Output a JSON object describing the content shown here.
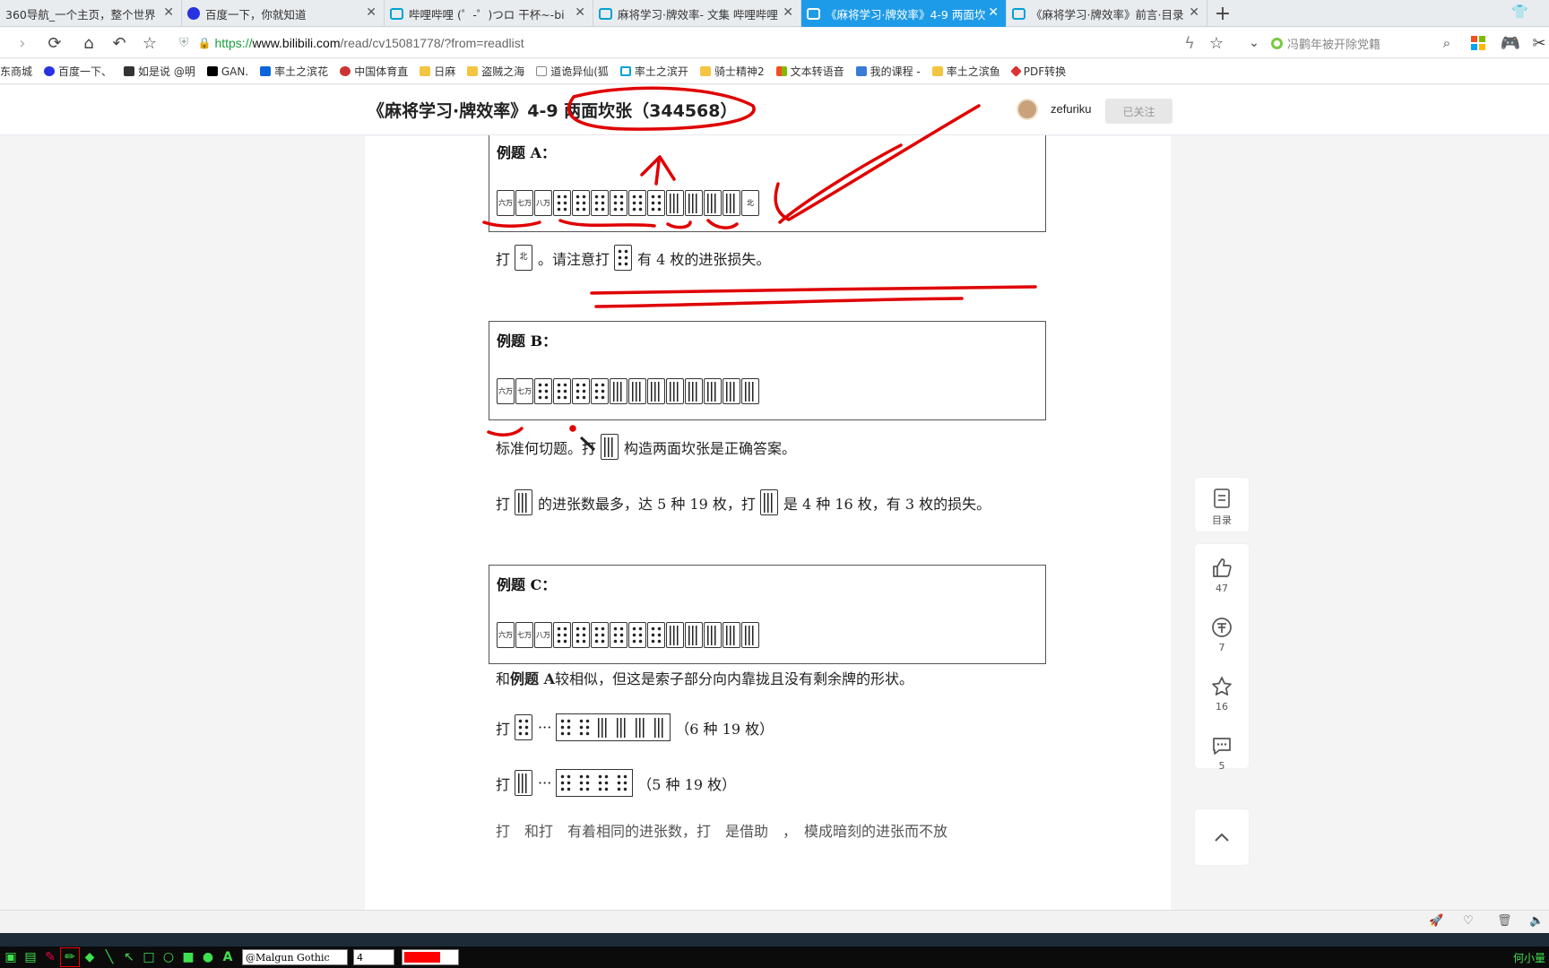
{
  "tabs": [
    {
      "title": "360导航_一个主页，整个世界",
      "icon": "nav360-icon",
      "active": false
    },
    {
      "title": "百度一下，你就知道",
      "icon": "baidu-icon",
      "active": false
    },
    {
      "title": "哔哩哔哩 (゜-゜)つロ 干杯~-bi",
      "icon": "bilibili-icon",
      "active": false
    },
    {
      "title": "麻将学习·牌效率- 文集 哔哩哔哩",
      "icon": "bilibili-icon",
      "active": false
    },
    {
      "title": "《麻将学习·牌效率》4-9 两面坎",
      "icon": "bilibili-icon",
      "active": true
    },
    {
      "title": "《麻将学习·牌效率》前言·目录",
      "icon": "bilibili-icon",
      "active": false
    }
  ],
  "address": {
    "scheme": "https://",
    "host": "www.bilibili.com",
    "path": "/read/cv15081778/?from=readlist",
    "search_placeholder": "冯鹳年被开除党籍"
  },
  "bookmarks": [
    "东商城",
    "百度一下、",
    "如是说 @明",
    "GAN.",
    "率土之滨花",
    "中国体育直",
    "日麻",
    "盗贼之海",
    "道诡异仙(狐",
    "率土之滨开",
    "骑士精神2",
    "文本转语音",
    "我的课程 -",
    "率土之滨鱼",
    "PDF转换"
  ],
  "article": {
    "title": "《麻将学习·牌效率》4-9 两面坎张（344568）",
    "author": "zefuriku",
    "follow_label": "已关注",
    "example_a": {
      "label": "例题 A：",
      "tiles": [
        "六万",
        "七万",
        "八万",
        "p",
        "p",
        "p",
        "p",
        "p",
        "p",
        "s",
        "s",
        "s",
        "s",
        "北"
      ],
      "text_before": "打",
      "tile_discard": "北",
      "text_mid": "。请注意打",
      "text_after": "有 4 枚的进张损失。"
    },
    "example_b": {
      "label": "例题 B：",
      "tiles": [
        "六万",
        "七万",
        "p",
        "p",
        "p",
        "p",
        "s",
        "s",
        "s",
        "s",
        "s",
        "s",
        "s",
        "s"
      ],
      "line1_a": "标准何切题。打",
      "line1_b": "构造两面坎张是正确答案。",
      "line2_a": "打",
      "line2_b": "的进张数最多，达 5 种 19 枚，打",
      "line2_c": "是 4 种 16 枚，有 3 枚的损失。"
    },
    "example_c": {
      "label": "例题 C：",
      "tiles": [
        "六万",
        "七万",
        "八万",
        "p",
        "p",
        "p",
        "p",
        "p",
        "p",
        "s",
        "s",
        "s",
        "s",
        "s"
      ],
      "line1_a": "和",
      "line1_b": "例题 A",
      "line1_c": "较相似，但这是索子部分向内靠拢且没有剩余牌的形状。",
      "line2_a": "打",
      "line2_b": "···",
      "line2_c": "（6 种 19 枚）",
      "line3_a": "打",
      "line3_b": "···",
      "line3_c": "（5 种 19 枚）",
      "line4": "打　和打　有着相同的进张数，打　是借助　，　模成暗刻的进张而不放"
    }
  },
  "sidebar": {
    "toc_label": "目录",
    "likes": "47",
    "coins": "7",
    "favorites": "16",
    "comments": "5"
  },
  "drawtool": {
    "font": "@Malgun Gothic",
    "size": "4",
    "color": "#ff0000",
    "user": "何小量"
  },
  "colors": {
    "accent": "#00a1d6",
    "active_tab": "#1e9be8",
    "annotation": "#e00000"
  }
}
